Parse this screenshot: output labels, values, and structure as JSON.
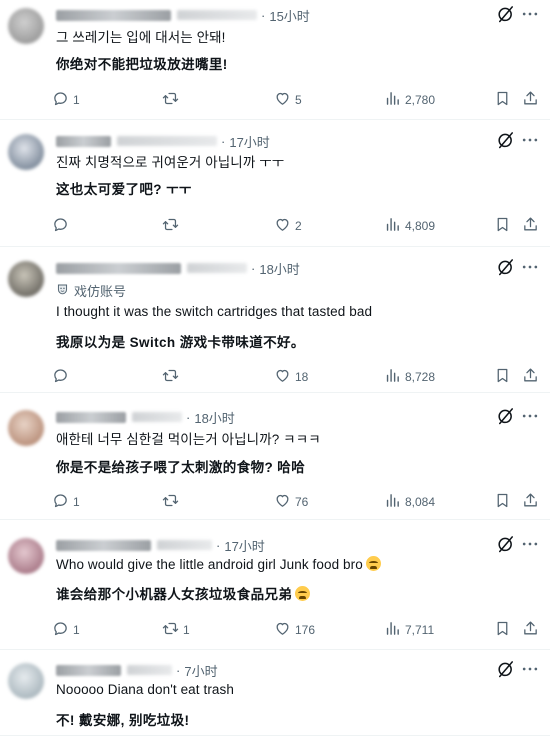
{
  "colors": {
    "text_primary": "#0f1419",
    "text_secondary": "#536471",
    "divider": "#eff3f4",
    "emoji": "#ffcc4d"
  },
  "icons": {
    "reply": "reply-icon",
    "repost": "repost-icon",
    "like": "like-icon",
    "views": "views-icon",
    "bookmark": "bookmark-icon",
    "share": "share-icon",
    "grok": "grok-icon",
    "more": "more-icon"
  },
  "replies": [
    {
      "time": "15小时",
      "original": "그 쓰레기는 입에 대서는 안돼!",
      "translation": "你绝对不能把垃圾放进嘴里!",
      "reply_count": "1",
      "repost_count": "",
      "like_count": "5",
      "view_count": "2,780"
    },
    {
      "time": "17小时",
      "original": "진짜 치명적으로 귀여운거 아닙니까 ㅜㅜ",
      "translation": "这也太可爱了吧? ㅜㅜ",
      "reply_count": "",
      "repost_count": "",
      "like_count": "2",
      "view_count": "4,809"
    },
    {
      "time": "18小时",
      "label": "戏仿账号",
      "original": "I thought it was the switch cartridges that tasted bad",
      "translation": "我原以为是 Switch 游戏卡带味道不好。",
      "reply_count": "",
      "repost_count": "",
      "like_count": "18",
      "view_count": "8,728"
    },
    {
      "time": "18小时",
      "original": "애한테 너무 심한걸 먹이는거 아닙니까? ㅋㅋㅋ",
      "translation": "你是不是给孩子喂了太刺激的食物? 哈哈",
      "reply_count": "1",
      "repost_count": "",
      "like_count": "76",
      "view_count": "8,084"
    },
    {
      "time": "17小时",
      "original": "Who would give the little android girl Junk food bro",
      "translation": "谁会给那个小机器人女孩垃圾食品兄弟",
      "reply_count": "1",
      "repost_count": "1",
      "like_count": "176",
      "view_count": "7,711"
    },
    {
      "time": "7小时",
      "original": "Nooooo Diana don't eat trash",
      "translation": "不! 戴安娜, 别吃垃圾!",
      "reply_count": "",
      "repost_count": "",
      "like_count": "",
      "view_count": ""
    }
  ]
}
